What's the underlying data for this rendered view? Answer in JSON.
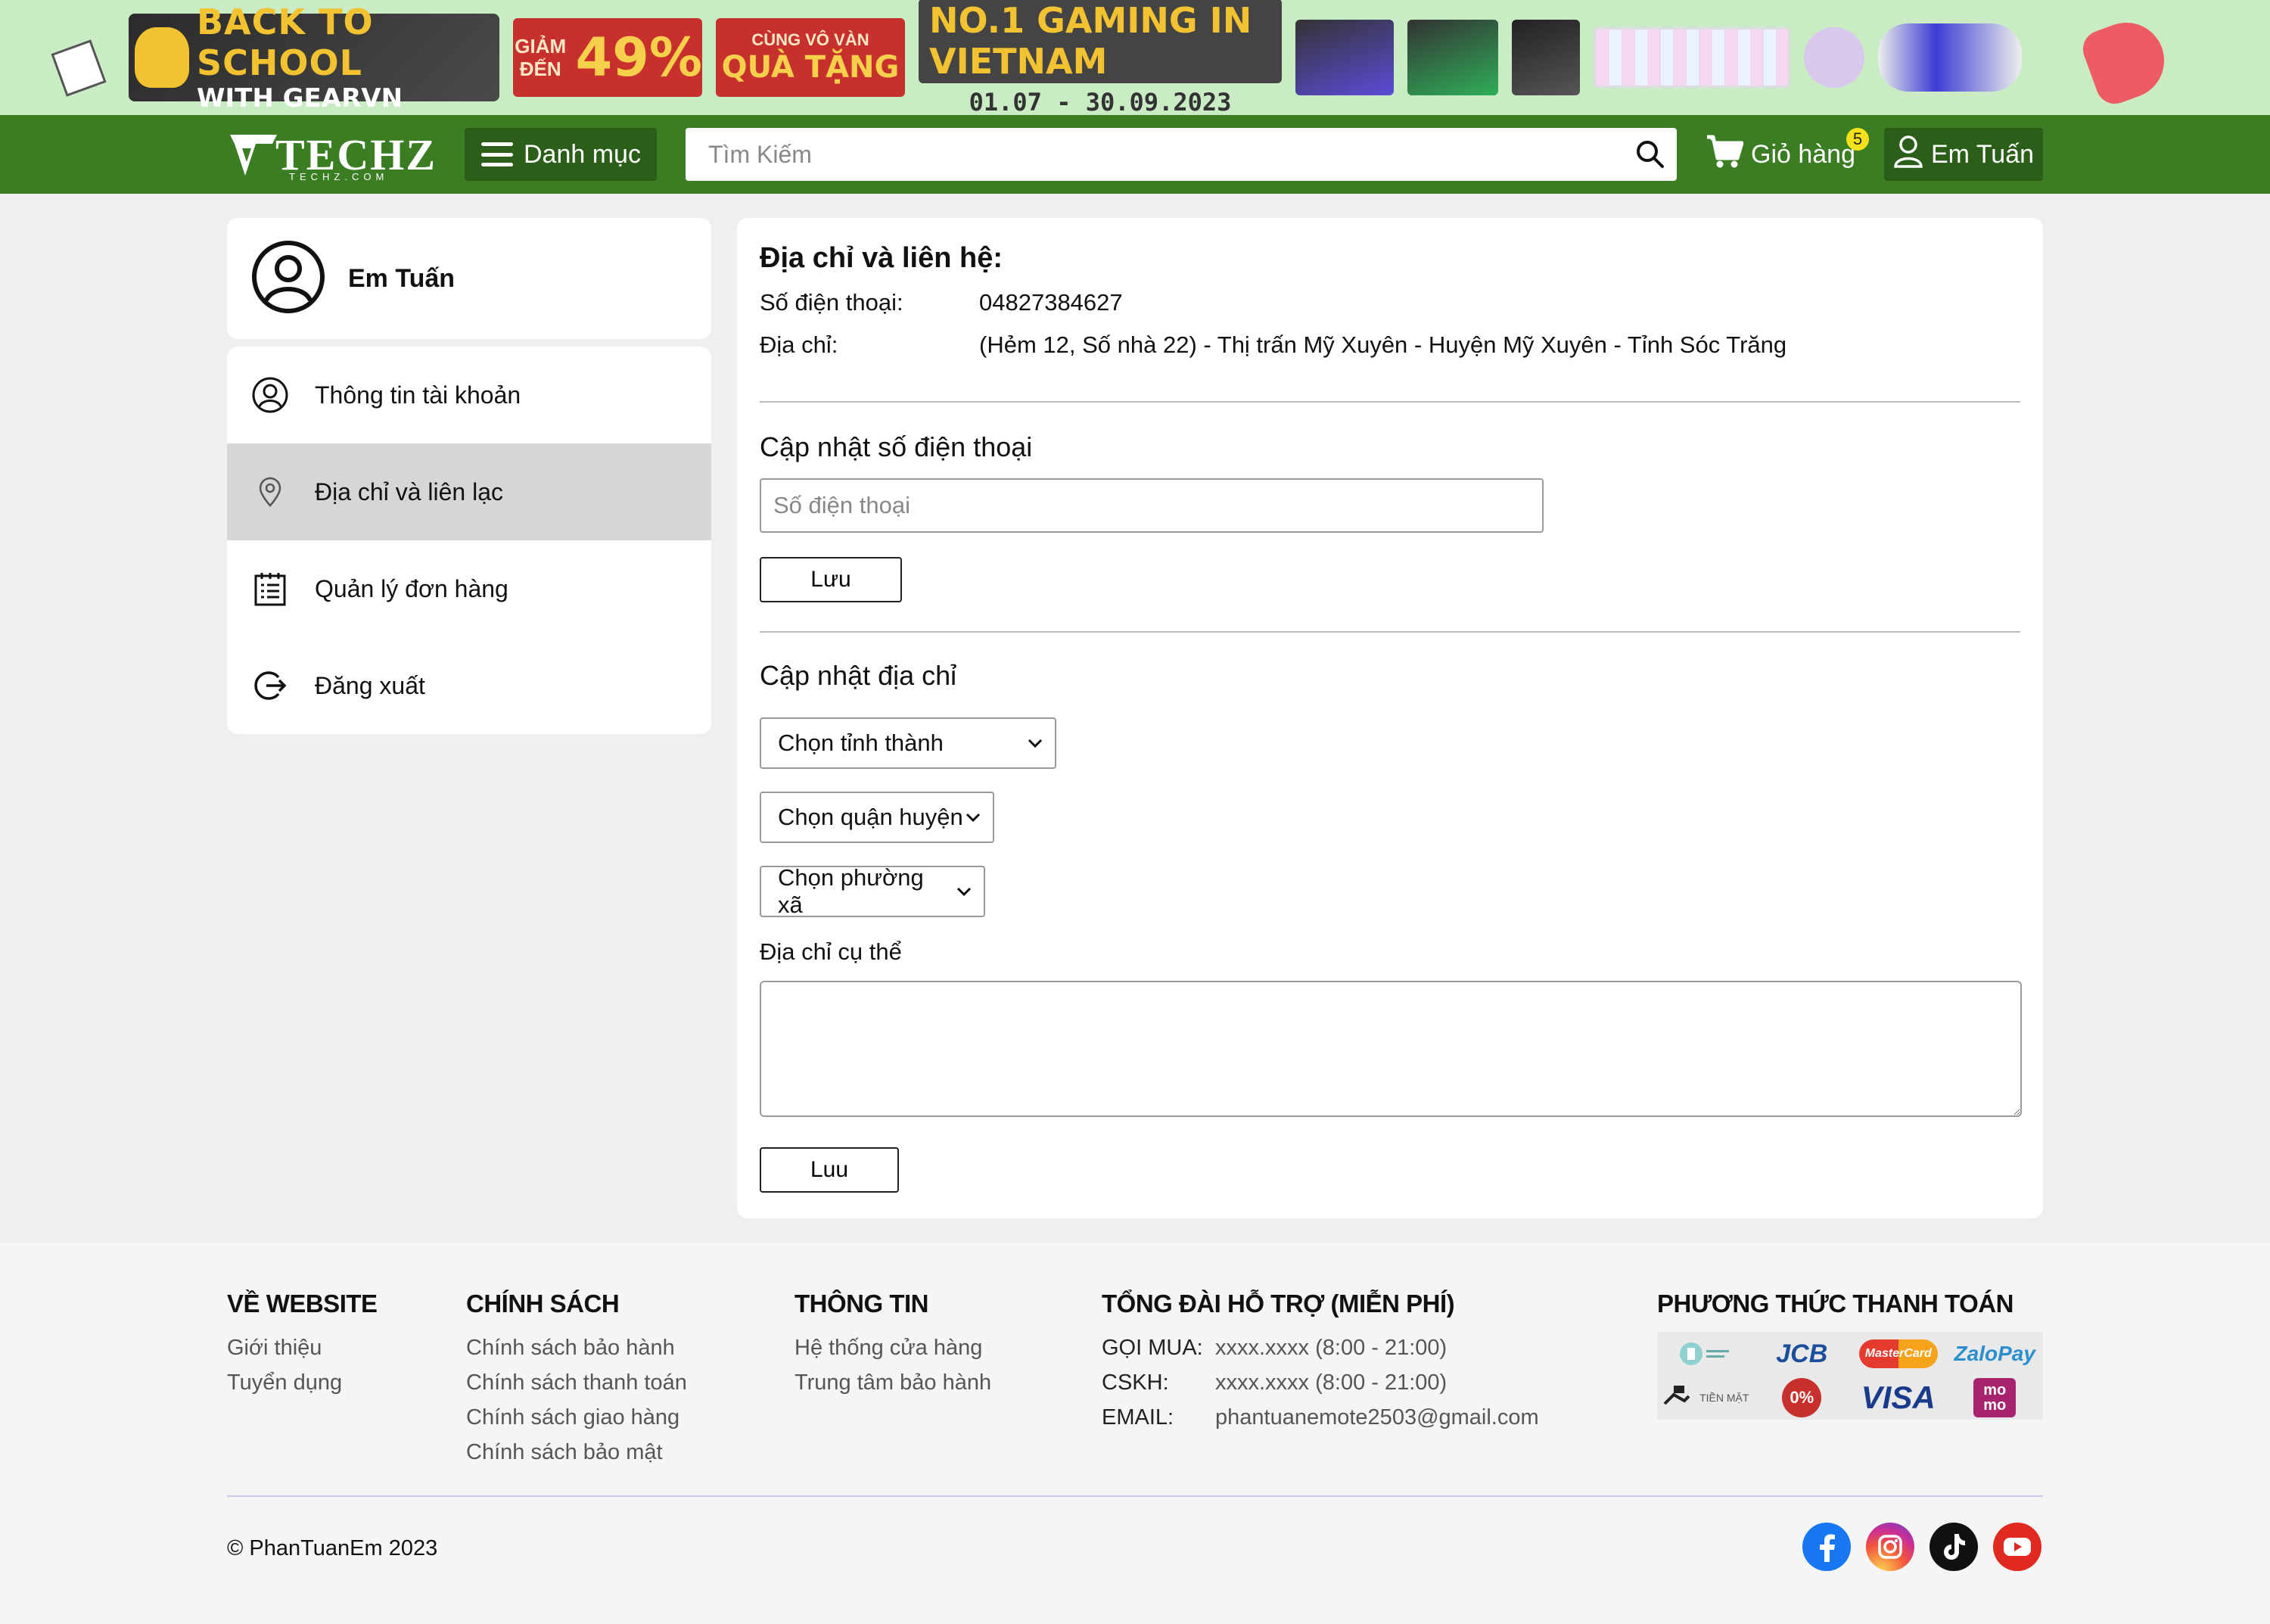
{
  "promo": {
    "back_to_school": "BACK TO SCHOOL",
    "with_gearvn": "WITH GEARVN",
    "discount_label": "GIẢM ĐẾN",
    "discount_value": "49%",
    "gift_line1": "CÙNG VÔ VÀN",
    "gift_line2": "QUÀ TẶNG",
    "no1": "NO.1 GAMING IN VIETNAM",
    "date_range": "01.07 - 30.09.2023"
  },
  "header": {
    "logo_text": "TECHZ",
    "logo_sub": "TECHZ.COM",
    "menu_label": "Danh mục",
    "search_placeholder": "Tìm Kiếm",
    "cart_label": "Giỏ hàng",
    "cart_count": "5",
    "user_label": "Em Tuấn"
  },
  "sidebar": {
    "user_name": "Em Tuấn",
    "items": [
      {
        "label": "Thông tin tài khoản",
        "icon": "user-circle-icon"
      },
      {
        "label": "Địa chỉ và liên lạc",
        "icon": "map-pin-icon"
      },
      {
        "label": "Quản lý đơn hàng",
        "icon": "clipboard-list-icon"
      },
      {
        "label": "Đăng xuất",
        "icon": "logout-icon"
      }
    ]
  },
  "main": {
    "title": "Địa chỉ và liên hệ:",
    "phone_key": "Số điện thoại:",
    "phone_value": "04827384627",
    "address_key": "Địa chỉ:",
    "address_value": "(Hẻm 12, Số nhà 22) - Thị trấn Mỹ Xuyên - Huyện Mỹ Xuyên - Tỉnh Sóc Trăng",
    "update_phone_title": "Cập nhật số điện thoại",
    "phone_placeholder": "Số điện thoại",
    "save_phone": "Lưu",
    "update_address_title": "Cập nhật địa chỉ",
    "select_province": "Chọn tỉnh thành",
    "select_district": "Chọn quận huyện",
    "select_ward": "Chọn phường xã",
    "detail_label": "Địa chỉ cụ thể",
    "save_address": "Luu"
  },
  "footer": {
    "about_title": "VỀ WEBSITE",
    "about_links": [
      "Giới thiệu",
      "Tuyển dụng"
    ],
    "policy_title": "CHÍNH SÁCH",
    "policy_links": [
      "Chính sách bảo hành",
      "Chính sách thanh toán",
      "Chính sách giao hàng",
      "Chính sách bảo mật"
    ],
    "info_title": "THÔNG TIN",
    "info_links": [
      "Hệ thống cửa hàng",
      "Trung tâm bảo hành"
    ],
    "support_title": "TỔNG ĐÀI HỖ TRỢ (MIỄN PHÍ)",
    "support": [
      {
        "k": "GỌI MUA:",
        "v": "xxxx.xxxx (8:00 - 21:00)"
      },
      {
        "k": "CSKH:",
        "v": "xxxx.xxxx (8:00 - 21:00)"
      },
      {
        "k": "EMAIL:",
        "v": "phantuanemote2503@gmail.com"
      }
    ],
    "payment_title": "PHƯƠNG THỨC THANH TOÁN",
    "payments": {
      "jcb": "JCB",
      "mastercard": "MasterCard",
      "zalopay": "ZaloPay",
      "cash": "TIỀN MẶT",
      "installment": "0%",
      "visa": "VISA",
      "momo": "mo mo"
    },
    "copyright": "© PhanTuanEm 2023"
  },
  "colors": {
    "header_green": "#3a7d22",
    "dark_green": "#2b5f19",
    "banner_bg": "#c9ecc4",
    "badge_yellow": "#f5e21c"
  }
}
